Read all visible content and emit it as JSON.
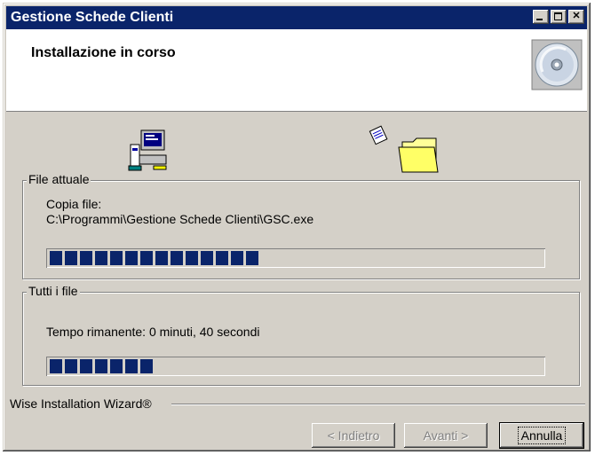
{
  "window": {
    "title": "Gestione Schede Clienti"
  },
  "header": {
    "title": "Installazione in corso"
  },
  "current_file": {
    "legend": "File attuale",
    "line1": "Copia file:",
    "line2": "C:\\Programmi\\Gestione Schede Clienti\\GSC.exe",
    "progress_blocks": 14
  },
  "all_files": {
    "legend": "Tutti i file",
    "status": "Tempo rimanente: 0 minuti, 40 secondi",
    "progress_blocks": 7
  },
  "brand": "Wise Installation Wizard®",
  "buttons": {
    "back": "< Indietro",
    "next": "Avanti >",
    "cancel": "Annulla"
  },
  "colors": {
    "titlebar": "#0a246a",
    "progress": "#0a246a",
    "face": "#d4d0c8"
  }
}
